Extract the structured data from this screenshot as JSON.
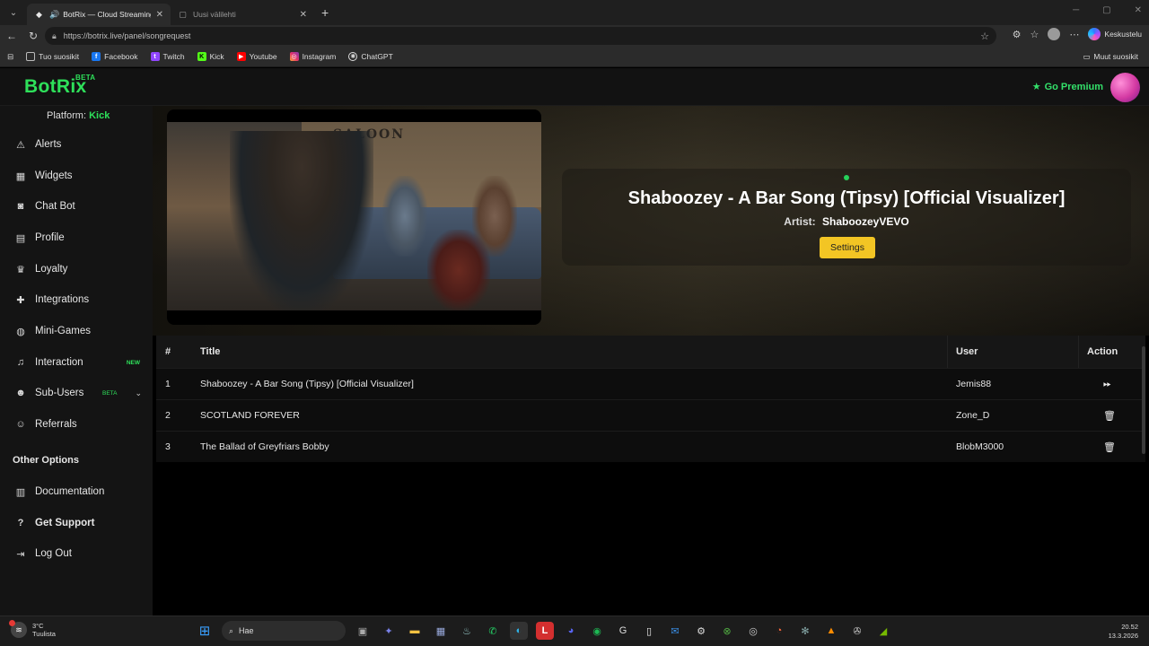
{
  "browser": {
    "tabs": [
      {
        "title": "BotRix — Cloud Streaming Bot",
        "active": true
      },
      {
        "title": "Uusi välilehti",
        "active": false
      }
    ],
    "url": "https://botrix.live/panel/songrequest",
    "profile_label": "Keskustelu",
    "bookmarks": [
      "Tuo suosikit",
      "Facebook",
      "Twitch",
      "Kick",
      "Youtube",
      "Instagram",
      "ChatGPT"
    ],
    "other_bookmarks": "Muut suosikit"
  },
  "app": {
    "logo": "BotRix",
    "logo_badge": "BETA",
    "premium_label": "Go Premium",
    "platform_label": "Platform:",
    "platform_value": "Kick",
    "sidebar": [
      {
        "label": "Alerts",
        "icon": "warning-icon"
      },
      {
        "label": "Widgets",
        "icon": "grid-icon"
      },
      {
        "label": "Chat Bot",
        "icon": "robot-icon"
      },
      {
        "label": "Profile",
        "icon": "id-card-icon"
      },
      {
        "label": "Loyalty",
        "icon": "trophy-icon"
      },
      {
        "label": "Integrations",
        "icon": "puzzle-icon"
      },
      {
        "label": "Mini-Games",
        "icon": "gamepad-icon"
      },
      {
        "label": "Interaction",
        "icon": "music-icon",
        "badge": "NEW"
      },
      {
        "label": "Sub-Users",
        "icon": "users-icon",
        "badge": "BETA"
      },
      {
        "label": "Referrals",
        "icon": "user-group-icon"
      }
    ],
    "other_options_title": "Other Options",
    "other_options": [
      {
        "label": "Documentation",
        "icon": "book-icon"
      },
      {
        "label": "Get Support",
        "icon": "question-icon"
      },
      {
        "label": "Log Out",
        "icon": "logout-icon"
      }
    ]
  },
  "now_playing": {
    "title": "Shaboozey - A Bar Song (Tipsy) [Official Visualizer]",
    "artist_label": "Artist:",
    "artist": "ShaboozeyVEVO",
    "settings_label": "Settings",
    "video_sign": "SALOON"
  },
  "queue": {
    "headers": {
      "num": "#",
      "title": "Title",
      "user": "User",
      "action": "Action"
    },
    "rows": [
      {
        "num": "1",
        "title": "Shaboozey - A Bar Song (Tipsy) [Official Visualizer]",
        "user": "Jemis88",
        "action": "skip-icon"
      },
      {
        "num": "2",
        "title": "SCOTLAND FOREVER",
        "user": "Zone_D",
        "action": "trash-icon"
      },
      {
        "num": "3",
        "title": "The Ballad of Greyfriars Bobby",
        "user": "BlobM3000",
        "action": "trash-icon"
      }
    ]
  },
  "taskbar": {
    "temp": "3°C",
    "weather": "Tuulista",
    "search_placeholder": "Hae",
    "time": "20.52",
    "date": "13.3.2026"
  },
  "colors": {
    "accent": "#2ee05a",
    "settings_button": "#f3c524"
  }
}
